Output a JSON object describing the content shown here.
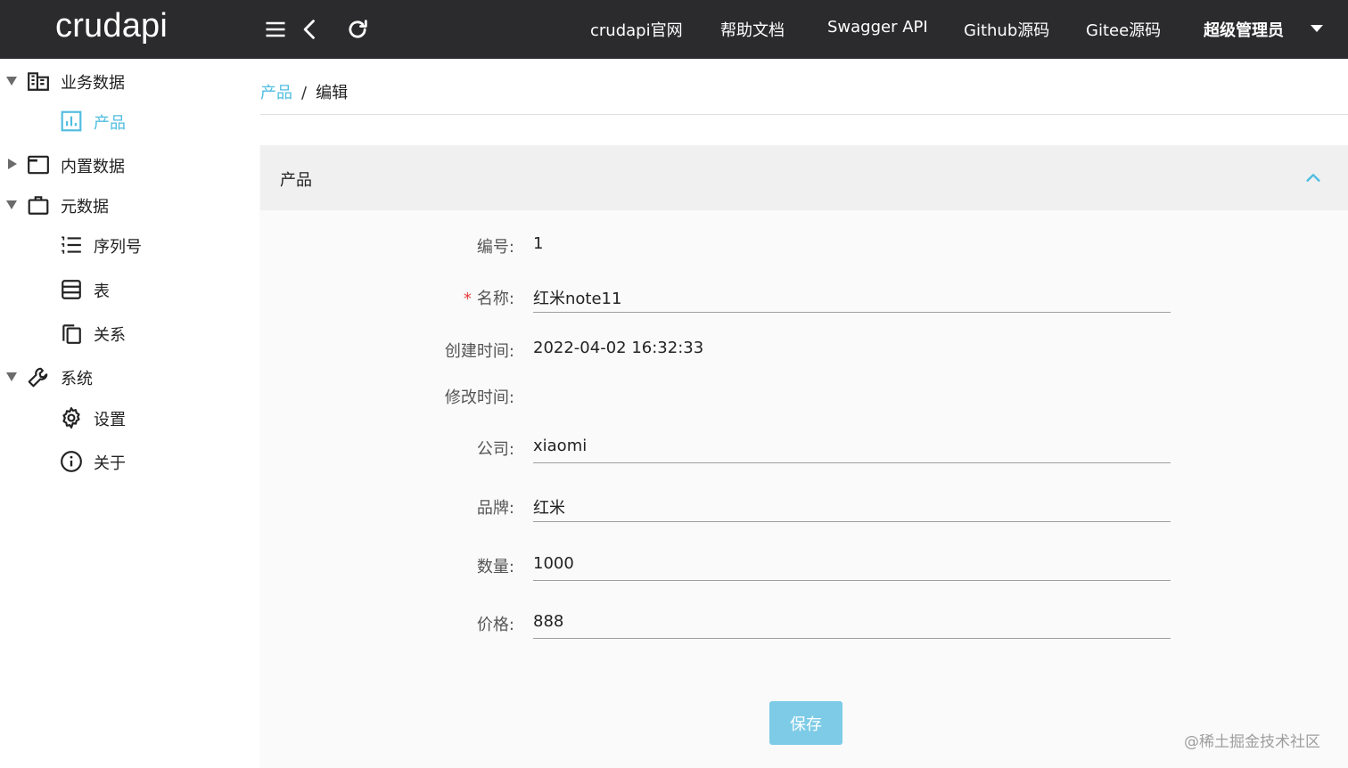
{
  "header": {
    "logo": "crudapi",
    "nav": [
      "crudapi官网",
      "帮助文档",
      "Swagger API",
      "Github源码",
      "Gitee源码"
    ],
    "user": "超级管理员"
  },
  "sidebar": {
    "items": [
      {
        "label": "业务数据",
        "icon": "business-data-icon",
        "arrow": "down"
      },
      {
        "label": "产品",
        "icon": "chart-icon",
        "active": true
      },
      {
        "label": "内置数据",
        "icon": "window-icon",
        "arrow": "right"
      },
      {
        "label": "元数据",
        "icon": "briefcase-icon",
        "arrow": "down"
      },
      {
        "label": "序列号",
        "icon": "list-icon"
      },
      {
        "label": "表",
        "icon": "table-icon"
      },
      {
        "label": "关系",
        "icon": "copy-icon"
      },
      {
        "label": "系统",
        "icon": "wrench-icon",
        "arrow": "down"
      },
      {
        "label": "设置",
        "icon": "gear-icon"
      },
      {
        "label": "关于",
        "icon": "info-icon"
      }
    ]
  },
  "breadcrumb": {
    "parent": "产品",
    "separator": "/",
    "current": "编辑"
  },
  "panel": {
    "title": "产品"
  },
  "form": {
    "id": {
      "label": "编号:",
      "value": "1"
    },
    "name": {
      "required_mark": "*",
      "label": "名称:",
      "value": "红米note11"
    },
    "create_time": {
      "label": "创建时间:",
      "value": "2022-04-02 16:32:33"
    },
    "update_time": {
      "label": "修改时间:",
      "value": ""
    },
    "company": {
      "label": "公司:",
      "value": "xiaomi"
    },
    "brand": {
      "label": "品牌:",
      "value": "红米"
    },
    "quantity": {
      "label": "数量:",
      "value": "1000"
    },
    "price": {
      "label": "价格:",
      "value": "888"
    },
    "save_label": "保存"
  },
  "watermark": "@稀土掘金技术社区",
  "colors": {
    "header_bg": "#2b2b2d",
    "accent": "#4fbde0",
    "button": "#7dcbe6"
  }
}
